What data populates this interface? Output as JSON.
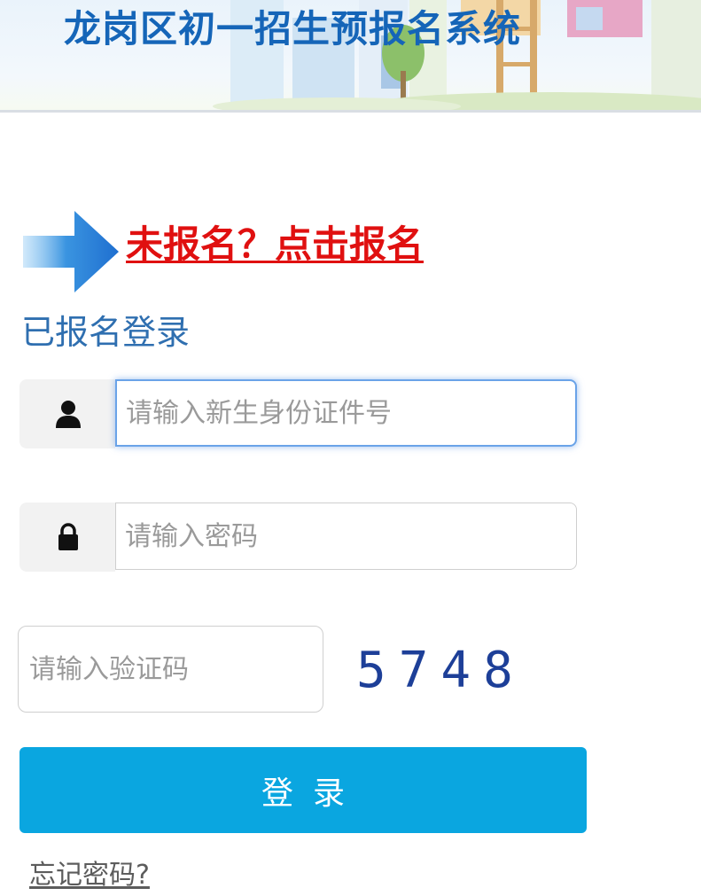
{
  "banner": {
    "title": "龙岗区初一招生预报名系统"
  },
  "register": {
    "link_text": "未报名？点击报名"
  },
  "login": {
    "subtitle": "已报名登录",
    "id_field": {
      "placeholder": "请输入新生身份证件号",
      "value": ""
    },
    "password_field": {
      "placeholder": "请输入密码",
      "value": ""
    },
    "captcha_field": {
      "placeholder": "请输入验证码",
      "value": ""
    },
    "captcha_code": "5748",
    "submit_label": "登录",
    "forgot_label": "忘记密码?"
  },
  "colors": {
    "title_blue": "#1565b8",
    "register_red": "#e01010",
    "subtitle_blue": "#2f6fb0",
    "button_blue": "#0aa6e0",
    "captcha_blue": "#1d3f98"
  },
  "icons": {
    "arrow": "arrow-right-icon",
    "user": "user-icon",
    "lock": "lock-icon"
  }
}
